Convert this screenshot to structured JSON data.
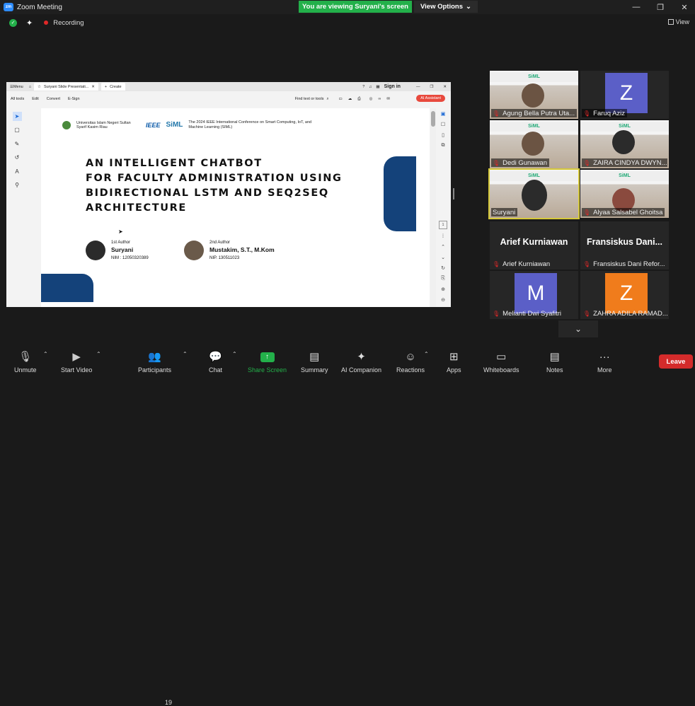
{
  "window": {
    "title": "Zoom Meeting",
    "viewing_banner": "You are viewing Suryani's screen",
    "view_options": "View Options",
    "recording": "Recording",
    "view": "View"
  },
  "pdf": {
    "menu": "Menu",
    "tab_title": "Suryani Slide Presentati...",
    "create": "Create",
    "sign_in": "Sign in",
    "tools": [
      "All tools",
      "Edit",
      "Convert",
      "E-Sign"
    ],
    "find": "Find text or tools",
    "ai_assistant": "AI Assistant"
  },
  "slide": {
    "university": "Universitas Islam Negeri Sultan Syarif Kasim Riau",
    "ieee": "IEEE",
    "siml": "SiML",
    "conference": "The 2024 IEEE International Conference on Smart Computing, IoT, and Machine Learning (SIML)",
    "title_lines": [
      "AN INTELLIGENT CHATBOT",
      "FOR FACULTY ADMINISTRATION USING",
      "BIDIRECTIONAL LSTM AND SEQ2SEQ",
      "ARCHITECTURE"
    ],
    "author1": {
      "role": "1st Author",
      "name": "Suryani",
      "id": "NIM : 12050320389"
    },
    "author2": {
      "role": "2nd Author",
      "name": "Mustakim, S.T., M.Kom",
      "id": "NIP. 130511023"
    }
  },
  "participants_gallery": [
    {
      "name": "Agung Bella Putra Uta...",
      "type": "video"
    },
    {
      "name": "Faruq Aziz",
      "type": "avatar",
      "letter": "Z",
      "color": "#5b5fc7"
    },
    {
      "name": "Dedi Gunawan",
      "type": "video"
    },
    {
      "name": "ZAIRA CINDYA DWYN...",
      "type": "video"
    },
    {
      "name": "Suryani",
      "type": "video",
      "active": true
    },
    {
      "name": "Alyaa Salsabel Ghoitsa",
      "type": "video"
    },
    {
      "name": "Arief Kurniawan",
      "type": "name",
      "display": "Arief Kurniawan"
    },
    {
      "name": "Fransiskus Dani Refor...",
      "type": "name",
      "display": "Fransiskus Dani..."
    },
    {
      "name": "Melianti Dwi Syafitri",
      "type": "avatar",
      "letter": "M",
      "color": "#5b5fc7"
    },
    {
      "name": "ZAHRA ADILA RAMAD...",
      "type": "avatar",
      "letter": "Z",
      "color": "#f07c1c"
    }
  ],
  "toolbar": {
    "unmute": "Unmute",
    "start_video": "Start Video",
    "participants": "Participants",
    "participants_count": "19",
    "chat": "Chat",
    "share_screen": "Share Screen",
    "summary": "Summary",
    "ai_companion": "AI Companion",
    "reactions": "Reactions",
    "apps": "Apps",
    "whiteboards": "Whiteboards",
    "notes": "Notes",
    "more": "More",
    "leave": "Leave"
  },
  "colors": {
    "accent_green": "#23b04a",
    "leave_red": "#d42b2b",
    "slide_blue": "#14427a"
  }
}
